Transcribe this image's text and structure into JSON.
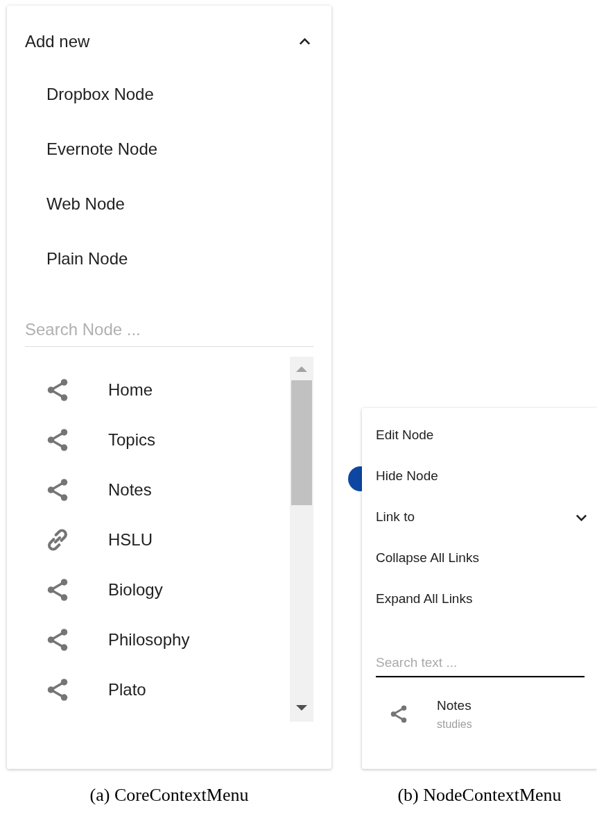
{
  "core_menu": {
    "add_new": {
      "label": "Add new",
      "expanded": true,
      "items": [
        "Dropbox Node",
        "Evernote Node",
        "Web Node",
        "Plain Node"
      ]
    },
    "search": {
      "placeholder": "Search Node ..."
    },
    "nodes": [
      {
        "label": "Home",
        "kind": "share"
      },
      {
        "label": "Topics",
        "kind": "share"
      },
      {
        "label": "Notes",
        "kind": "share"
      },
      {
        "label": "HSLU",
        "kind": "link"
      },
      {
        "label": "Biology",
        "kind": "share"
      },
      {
        "label": "Philosophy",
        "kind": "share"
      },
      {
        "label": "Plato",
        "kind": "share"
      }
    ],
    "caption": "(a) CoreContextMenu"
  },
  "node_menu": {
    "items": [
      {
        "label": "Edit Node",
        "kind": "plain"
      },
      {
        "label": "Hide Node",
        "kind": "plain"
      },
      {
        "label": "Link to",
        "kind": "expander",
        "expanded": false
      },
      {
        "label": "Collapse All Links",
        "kind": "plain"
      },
      {
        "label": "Expand All Links",
        "kind": "plain"
      }
    ],
    "search": {
      "placeholder": "Search text ...",
      "focused": true
    },
    "results": [
      {
        "title": "Notes",
        "subtitle": "studies",
        "kind": "share"
      }
    ],
    "caption": "(b) NodeContextMenu"
  }
}
